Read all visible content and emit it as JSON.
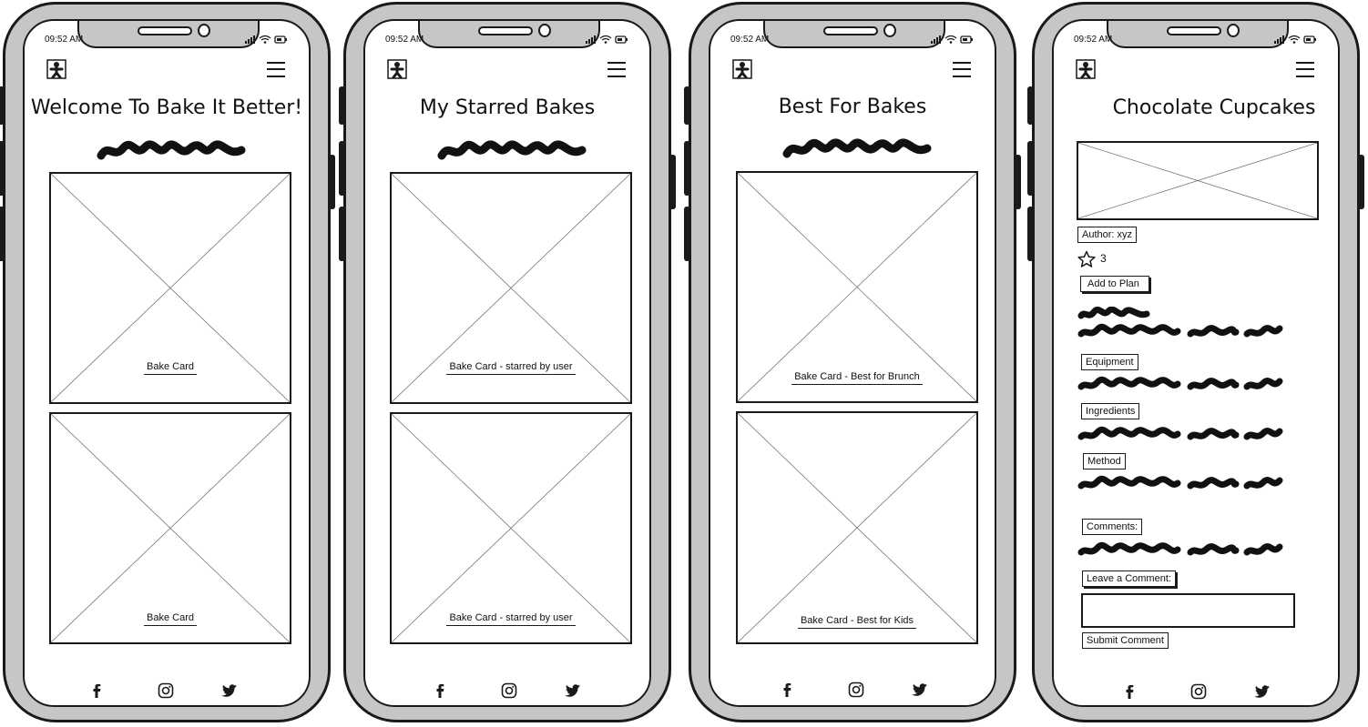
{
  "status_bar": {
    "time": "09:52 AM"
  },
  "screens": [
    {
      "title": "Welcome To Bake It Better!",
      "cards": [
        {
          "caption": "Bake Card"
        },
        {
          "caption": "Bake Card"
        }
      ]
    },
    {
      "title": "My Starred Bakes",
      "cards": [
        {
          "caption": "Bake Card - starred by user"
        },
        {
          "caption": "Bake Card - starred by user"
        }
      ]
    },
    {
      "title": "Best For Bakes",
      "cards": [
        {
          "caption": "Bake Card - Best for Brunch"
        },
        {
          "caption": "Bake Card - Best for Kids"
        }
      ]
    },
    {
      "title": "Chocolate Cupcakes",
      "author": "Author: xyz",
      "star_count": "3",
      "add_to_plan": "Add to Plan",
      "sections": {
        "equipment": "Equipment",
        "ingredients": "Ingredients",
        "method": "Method",
        "comments": "Comments:"
      },
      "leave_comment": "Leave a Comment:",
      "comment_input": {
        "value": "",
        "placeholder": ""
      },
      "submit": "Submit Comment"
    }
  ],
  "icons": {
    "logo": "gingerbread-man-icon",
    "menu": "hamburger-menu-icon",
    "social": [
      "facebook-icon",
      "instagram-icon",
      "twitter-icon"
    ],
    "rating": "star-outline-icon"
  },
  "colors": {
    "frame": "#c6c6c6",
    "ink": "#1a1a1a",
    "screen": "#ffffff",
    "placeholder_lines": "#666666"
  }
}
